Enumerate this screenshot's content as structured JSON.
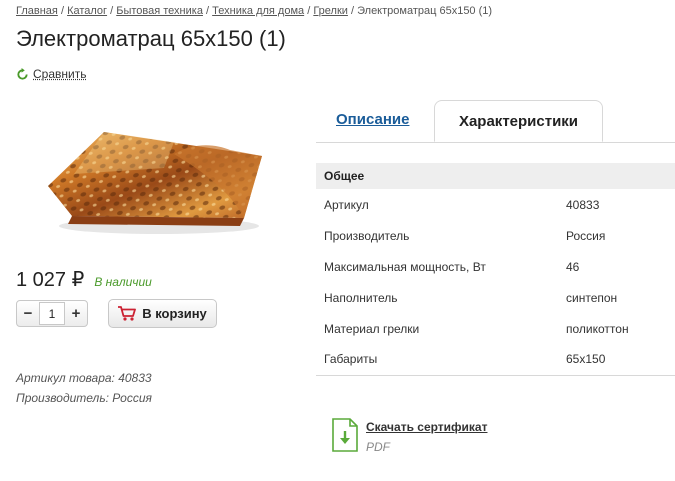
{
  "breadcrumb": {
    "items": [
      "Главная",
      "Каталог",
      "Бытовая техника",
      "Техника для дома",
      "Грелки"
    ],
    "current": "Электроматрац 65x150 (1)",
    "separator": "/"
  },
  "product": {
    "title": "Электроматрац 65x150 (1)",
    "compare_label": "Сравнить",
    "price": "1 027 ₽",
    "stock": "В наличии",
    "quantity": "1",
    "qty_minus": "−",
    "qty_plus": "+",
    "cart_label": "В корзину",
    "article_line": "Артикул товара: 40833",
    "manufacturer_line": "Производитель: Россия"
  },
  "tabs": [
    {
      "label": "Описание",
      "active": false
    },
    {
      "label": "Характеристики",
      "active": true
    }
  ],
  "specs": {
    "group": "Общее",
    "rows": [
      {
        "label": "Артикул",
        "value": "40833"
      },
      {
        "label": "Производитель",
        "value": "Россия"
      },
      {
        "label": "Максимальная мощность, Вт",
        "value": "46"
      },
      {
        "label": "Наполнитель",
        "value": "синтепон"
      },
      {
        "label": "Материал грелки",
        "value": "поликоттон"
      },
      {
        "label": "Габариты",
        "value": "65x150"
      }
    ]
  },
  "certificate": {
    "link": "Скачать сертификат",
    "format": "PDF"
  },
  "colors": {
    "accent_green": "#4a9a2a",
    "tab_link": "#1a5c99",
    "cart_icon": "#cc2233"
  },
  "icons": {
    "compare": "refresh-icon",
    "cart": "cart-icon",
    "certificate": "pdf-download-icon"
  }
}
